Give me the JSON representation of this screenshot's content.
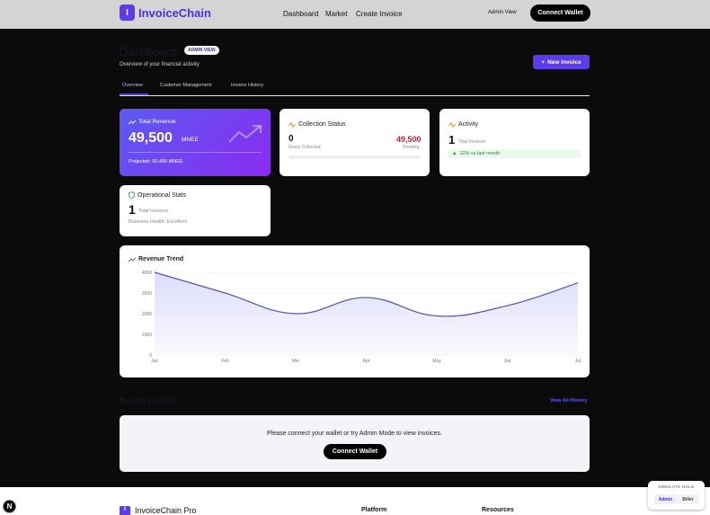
{
  "nav": {
    "logo_letter": "I",
    "brand": "InvoiceChain",
    "links": [
      "Dashboard",
      "Market",
      "Create Invoice"
    ],
    "admin_view": "Admin View",
    "connect_wallet": "Connect Wallet"
  },
  "header": {
    "title": "Dashboard",
    "badge": "ADMIN VIEW",
    "subtitle": "Overview of your financial activity",
    "new_invoice": "New Invoice"
  },
  "tabs": [
    "Overview",
    "Customer Management",
    "Invoice History"
  ],
  "revenue_card": {
    "title": "Total Revenue",
    "value": "49,500",
    "unit": "MNEE",
    "projected": "Projected: 50,400 MNEE"
  },
  "collection_card": {
    "title": "Collection Status",
    "collected_value": "0",
    "collected_label": "Gross Collected",
    "pending_value": "49,500",
    "pending_label": "Pending",
    "progress_fraction": 0
  },
  "activity_card": {
    "title": "Activity",
    "value": "1",
    "label": "Total Invoices",
    "growth": "12% vs last month"
  },
  "ops_card": {
    "title": "Operational Stats",
    "value": "1",
    "label": "Total Invoices",
    "health": "Business Health: Excellent"
  },
  "chart_data": {
    "type": "area",
    "title": "Revenue Trend",
    "categories": [
      "Jan",
      "Feb",
      "Mar",
      "Apr",
      "May",
      "Jun",
      "Jul"
    ],
    "y_ticks": [
      "0",
      "1000",
      "2000",
      "3000",
      "4000"
    ],
    "ylim": [
      0,
      4000
    ],
    "series": [
      {
        "values": [
          4000,
          3000,
          2000,
          2780,
          1890,
          2390,
          3490
        ]
      }
    ],
    "grid": true,
    "colors": {
      "line": "#5454b0",
      "fill": "#dcdcfb"
    }
  },
  "recent": {
    "title": "Recent Invoices",
    "view_all": "View All History",
    "empty_message": "Please connect your wallet or try Admin Mode to view invoices.",
    "connect_wallet": "Connect Wallet"
  },
  "footer": {
    "logo_letter": "I",
    "brand": "InvoiceChain Pro",
    "col_platform": "Platform",
    "col_resources": "Resources"
  },
  "floating": {
    "n_badge": "N",
    "role_title": "SIMULATE ROLE",
    "role_admin": "Admin",
    "role_biller": "Biller"
  },
  "colors": {
    "accent": "#5b3bea",
    "pending": "#c2243b",
    "growth": "#1c8a3a"
  }
}
